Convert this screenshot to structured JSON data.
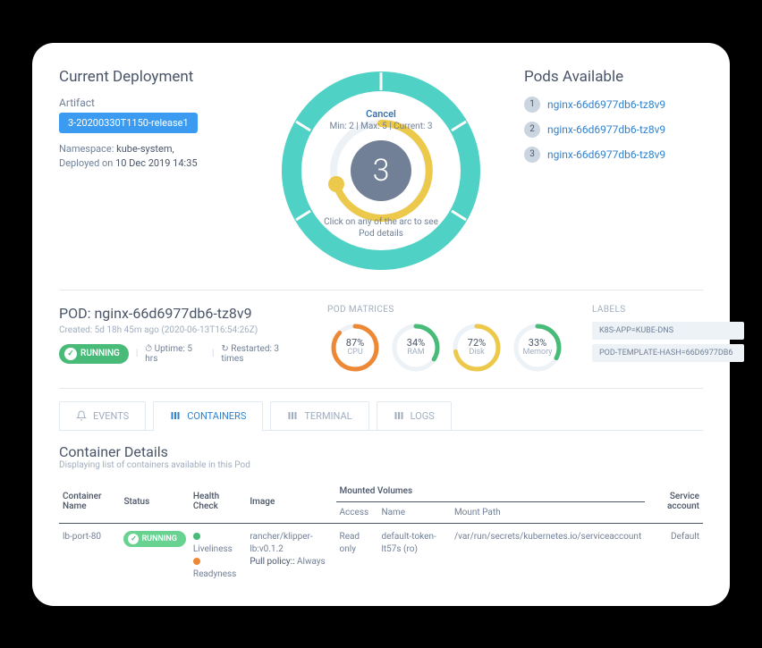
{
  "deployment": {
    "title": "Current Deployment",
    "artifact_label": "Artifact",
    "artifact": "3-20200330T1150-release1",
    "namespace_label": "Namespace:",
    "namespace": "kube-system,",
    "deployed_label": "Deployed on",
    "deployed": "10 Dec 2019 14:35"
  },
  "dial": {
    "cancel": "Cancel",
    "stats": "Min: 2 | Max: 5 | Current: 3",
    "count": "3",
    "hint": "Click on any of the arc to see Pod details"
  },
  "pods": {
    "title": "Pods Available",
    "items": [
      "nginx-66d6977db6-tz8v9",
      "nginx-66d6977db6-tz8v9",
      "nginx-66d6977db6-tz8v9"
    ]
  },
  "pod": {
    "name": "POD: nginx-66d6977db6-tz8v9",
    "created": "Created: 5d 18h 45m ago (2020-06-13T16:54:26Z)",
    "status": "RUNNING",
    "uptime_label": "Uptime:",
    "uptime": "5 hrs",
    "restart_label": "Restarted:",
    "restart": "3 times"
  },
  "metrics": {
    "title": "POD MATRICES",
    "items": [
      {
        "pct": 87,
        "label": "CPU",
        "color": "#ed8936"
      },
      {
        "pct": 34,
        "label": "RAM",
        "color": "#48bb78"
      },
      {
        "pct": 72,
        "label": "Disk",
        "color": "#ecc94b"
      },
      {
        "pct": 33,
        "label": "Memory",
        "color": "#48bb78"
      }
    ]
  },
  "labels": {
    "title": "LABELS",
    "items": [
      "K8S-APP=KUBE-DNS",
      "POD-TEMPLATE-HASH=66D6977DB6"
    ]
  },
  "tabs": {
    "events": "EVENTS",
    "containers": "CONTAINERS",
    "terminal": "TERMINAL",
    "logs": "LOGS"
  },
  "details": {
    "title": "Container Details",
    "sub": "Displaying list of containers available in this Pod",
    "headers": {
      "name": "Container Name",
      "status": "Status",
      "health": "Health Check",
      "image": "Image",
      "mounted": "Mounted Volumes",
      "access": "Access",
      "volname": "Name",
      "mountpath": "Mount Path",
      "svc": "Service account"
    },
    "row": {
      "name": "lb-port-80",
      "status": "RUNNING",
      "liveliness": "Liveliness",
      "readyness": "Readyness",
      "image": "rancher/klipper-lb:v0.1.2",
      "pull_label": "Pull policy::",
      "pull": "Always",
      "access": "Read only",
      "volname": "default-token-lt57s (ro)",
      "mountpath": "/var/run/secrets/kubernetes.io/serviceaccount",
      "svc": "Default"
    }
  }
}
